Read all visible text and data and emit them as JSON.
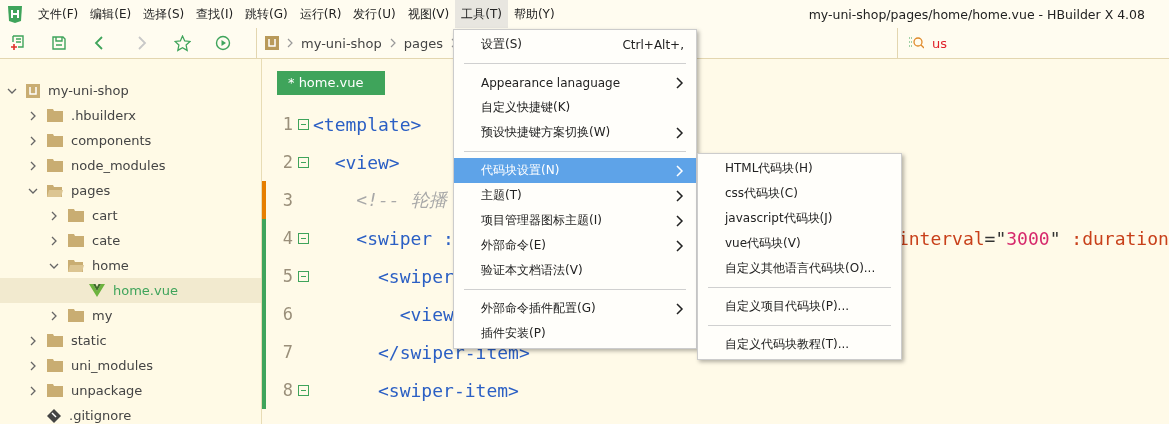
{
  "window": {
    "title": "my-uni-shop/pages/home/home.vue - HBuilder X 4.08"
  },
  "menubar": [
    {
      "label": "文件(F)",
      "selected": false
    },
    {
      "label": "编辑(E)",
      "selected": false
    },
    {
      "label": "选择(S)",
      "selected": false
    },
    {
      "label": "查找(I)",
      "selected": false
    },
    {
      "label": "跳转(G)",
      "selected": false
    },
    {
      "label": "运行(R)",
      "selected": false
    },
    {
      "label": "发行(U)",
      "selected": false
    },
    {
      "label": "视图(V)",
      "selected": false
    },
    {
      "label": "工具(T)",
      "selected": true
    },
    {
      "label": "帮助(Y)",
      "selected": false
    }
  ],
  "toolbar": [
    {
      "kind": "new-file",
      "disabled": false
    },
    {
      "kind": "save",
      "disabled": false
    },
    {
      "kind": "back",
      "disabled": false
    },
    {
      "kind": "forward",
      "disabled": true
    },
    {
      "kind": "star",
      "disabled": false
    },
    {
      "kind": "run",
      "disabled": false
    }
  ],
  "breadcrumb": [
    "my-uni-shop",
    "pages"
  ],
  "search": {
    "value": "us"
  },
  "tree": [
    {
      "name": "my-uni-shop",
      "kind": "project",
      "expanded": true,
      "selected": false,
      "children": [
        {
          "name": ".hbuilderx",
          "kind": "folder",
          "expanded": false,
          "selected": false
        },
        {
          "name": "components",
          "kind": "folder",
          "expanded": false,
          "selected": false
        },
        {
          "name": "node_modules",
          "kind": "folder",
          "expanded": false,
          "selected": false
        },
        {
          "name": "pages",
          "kind": "folder",
          "expanded": true,
          "selected": false,
          "children": [
            {
              "name": "cart",
              "kind": "folder",
              "expanded": false,
              "selected": false
            },
            {
              "name": "cate",
              "kind": "folder",
              "expanded": false,
              "selected": false
            },
            {
              "name": "home",
              "kind": "folder",
              "expanded": true,
              "selected": false,
              "children": [
                {
                  "name": "home.vue",
                  "kind": "vue",
                  "selected": true
                }
              ]
            },
            {
              "name": "my",
              "kind": "folder",
              "expanded": false,
              "selected": false
            }
          ]
        },
        {
          "name": "static",
          "kind": "folder",
          "expanded": false,
          "selected": false
        },
        {
          "name": "uni_modules",
          "kind": "folder",
          "expanded": false,
          "selected": false
        },
        {
          "name": "unpackage",
          "kind": "folder",
          "expanded": false,
          "selected": false
        },
        {
          "name": ".gitignore",
          "kind": "git"
        }
      ]
    }
  ],
  "tab": {
    "label": "* home.vue",
    "selected": true
  },
  "code": [
    {
      "number": "1",
      "foldable": true,
      "tokens": [
        {
          "kind": "tag",
          "text": "<template>"
        }
      ]
    },
    {
      "number": "2",
      "foldable": true,
      "tokens": [
        {
          "kind": "tag",
          "text": "  <view>"
        }
      ]
    },
    {
      "number": "3",
      "foldable": false,
      "color": "#e67e00",
      "tokens": [
        {
          "kind": "comment",
          "text": "    <!-- 轮播"
        }
      ]
    },
    {
      "number": "4",
      "foldable": true,
      "color": "#3fa45b",
      "tokens": [
        {
          "kind": "tag",
          "text": "    <swiper :"
        },
        {
          "kind": "covered"
        },
        {
          "kind": "attr",
          "text": "interval"
        },
        {
          "kind": "punct",
          "text": "=\""
        },
        {
          "kind": "string",
          "text": "3000"
        },
        {
          "kind": "punct",
          "text": "\""
        },
        {
          "kind": "attr",
          "text": " :duration"
        }
      ]
    },
    {
      "number": "5",
      "foldable": true,
      "color": "#3fa45b",
      "tokens": [
        {
          "kind": "tag",
          "text": "      <swiper"
        }
      ]
    },
    {
      "number": "6",
      "foldable": false,
      "color": "#3fa45b",
      "tokens": [
        {
          "kind": "tag",
          "text": "        <view"
        }
      ]
    },
    {
      "number": "7",
      "foldable": false,
      "color": "#3fa45b",
      "tokens": [
        {
          "kind": "tag",
          "text": "      </swiper-item>"
        }
      ]
    },
    {
      "number": "8",
      "foldable": true,
      "color": "#3fa45b",
      "tokens": [
        {
          "kind": "tag",
          "text": "      <swiper-item>"
        }
      ]
    }
  ],
  "menu": [
    {
      "kind": "item",
      "label": "设置(S)",
      "shortcut": "Ctrl+Alt+,",
      "submenu": false,
      "selected": false
    },
    {
      "kind": "separator"
    },
    {
      "kind": "item",
      "label": "Appearance lanaguage",
      "submenu": true,
      "selected": false
    },
    {
      "kind": "item",
      "label": "自定义快捷键(K)",
      "submenu": false,
      "selected": false
    },
    {
      "kind": "item",
      "label": "预设快捷键方案切换(W)",
      "submenu": true,
      "selected": false
    },
    {
      "kind": "separator"
    },
    {
      "kind": "item",
      "label": "代码块设置(N)",
      "submenu": true,
      "selected": true
    },
    {
      "kind": "item",
      "label": "主题(T)",
      "submenu": true,
      "selected": false
    },
    {
      "kind": "item",
      "label": "项目管理器图标主题(I)",
      "submenu": true,
      "selected": false
    },
    {
      "kind": "item",
      "label": "外部命令(E)",
      "submenu": true,
      "selected": false
    },
    {
      "kind": "item",
      "label": "验证本文档语法(V)",
      "submenu": false,
      "selected": false
    },
    {
      "kind": "separator"
    },
    {
      "kind": "item",
      "label": "外部命令插件配置(G)",
      "submenu": true,
      "selected": false
    },
    {
      "kind": "item",
      "label": "插件安装(P)",
      "submenu": false,
      "selected": false
    }
  ],
  "submenu": [
    {
      "kind": "item",
      "label": "HTML代码块(H)"
    },
    {
      "kind": "item",
      "label": "css代码块(C)"
    },
    {
      "kind": "item",
      "label": "javascript代码块(J)"
    },
    {
      "kind": "item",
      "label": "vue代码块(V)"
    },
    {
      "kind": "item",
      "label": "自定义其他语言代码块(O)..."
    },
    {
      "kind": "separator"
    },
    {
      "kind": "item",
      "label": "自定义项目代码块(P)..."
    },
    {
      "kind": "separator"
    },
    {
      "kind": "item",
      "label": "自定义代码块教程(T)..."
    }
  ]
}
